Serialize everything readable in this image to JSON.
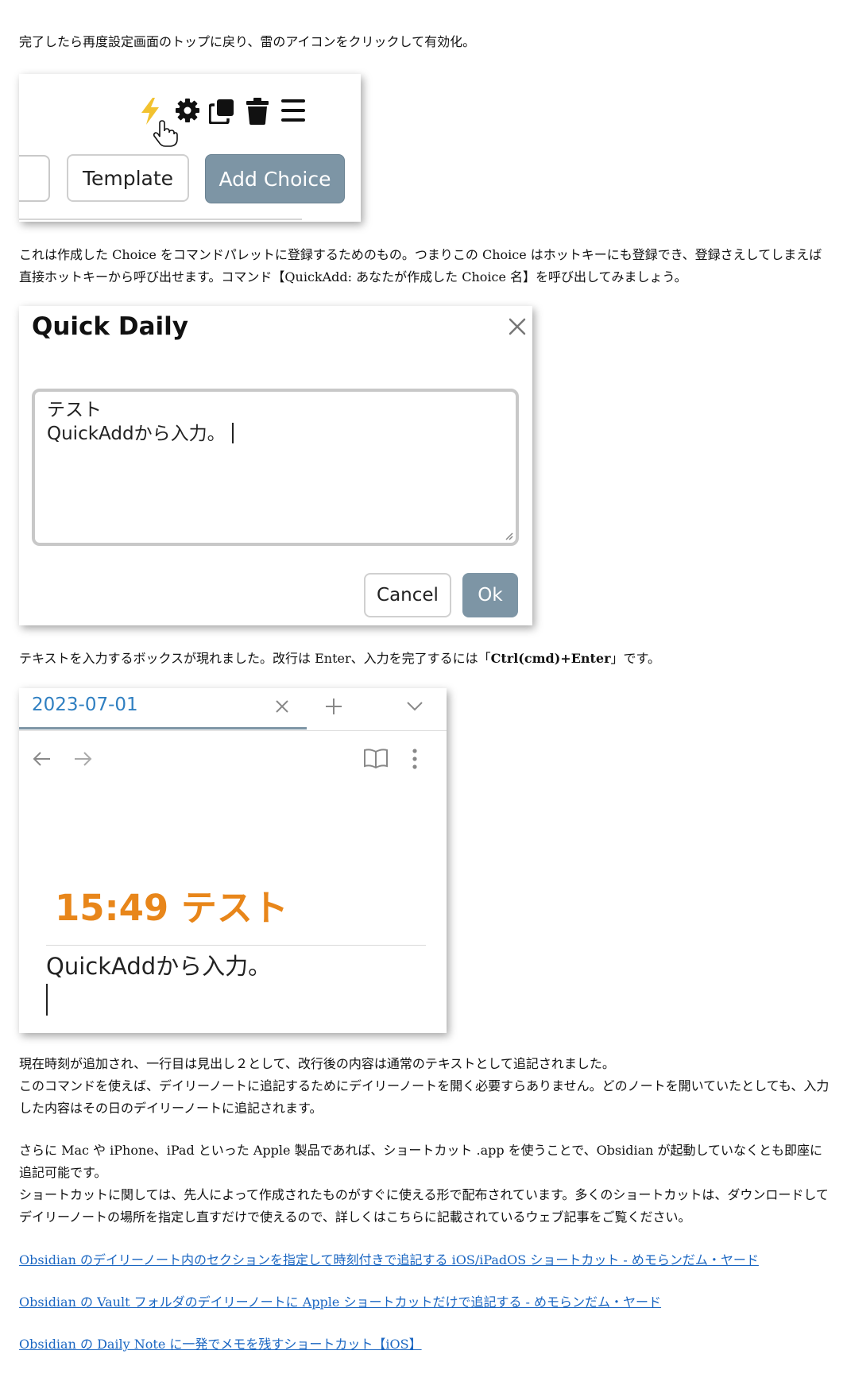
{
  "paragraphs": {
    "p1": "完了したら再度設定画面のトップに戻り、雷のアイコンをクリックして有効化。",
    "p2": "これは作成した Choice をコマンドパレットに登録するためのもの。つまりこの Choice はホットキーにも登録でき、登録さえしてしまえば直接ホットキーから呼び出せます。コマンド【QuickAdd: あなたが作成した Choice 名】を呼び出してみましょう。",
    "p3_before": "テキストを入力するボックスが現れました。改行は Enter、入力を完了するには「",
    "p3_bold": "Ctrl(cmd)+Enter",
    "p3_after": "」です。",
    "p4": "現在時刻が追加され、一行目は見出し２として、改行後の内容は通常のテキストとして追記されました。",
    "p5": "このコマンドを使えば、デイリーノートに追記するためにデイリーノートを開く必要すらありません。どのノートを開いていたとしても、入力した内容はその日のデイリーノートに追記されます。",
    "p6": "さらに Mac や iPhone、iPad といった Apple 製品であれば、ショートカット .app を使うことで、Obsidian が起動していなくとも即座に追記可能です。",
    "p7": "ショートカットに関しては、先人によって作成されたものがすぐに使える形で配布されています。多くのショートカットは、ダウンロードしてデイリーノートの場所を指定し直すだけで使えるので、詳しくはこちらに記載されているウェブ記事をご覧ください。"
  },
  "shot1": {
    "template_label": "Template",
    "add_choice_label": "Add Choice",
    "icons": [
      "lightning-icon",
      "gear-icon",
      "duplicate-icon",
      "trash-icon",
      "menu-icon",
      "hand-cursor-icon"
    ],
    "accent": "#7d95a5",
    "bolt_color": "#f2c230"
  },
  "shot2": {
    "title": "Quick Daily",
    "text_line1": "テスト",
    "text_line2": "QuickAddから入力。",
    "cancel_label": "Cancel",
    "ok_label": "Ok"
  },
  "shot3": {
    "tab_title": "2023-07-01",
    "heading": "15:49 テスト",
    "body_text": "QuickAddから入力。",
    "tab_color": "#2f7fc1",
    "heading_color": "#e8861a"
  },
  "links": [
    "Obsidian のデイリーノート内のセクションを指定して時刻付きで追記する iOS/iPadOS ショートカット - めモらンだム・ヤード",
    "Obsidian の Vault フォルダのデイリーノートに Apple ショートカットだけで追記する - めモらンだム・ヤード",
    "Obsidian の Daily Note に一発でメモを残すショートカット【iOS】"
  ]
}
